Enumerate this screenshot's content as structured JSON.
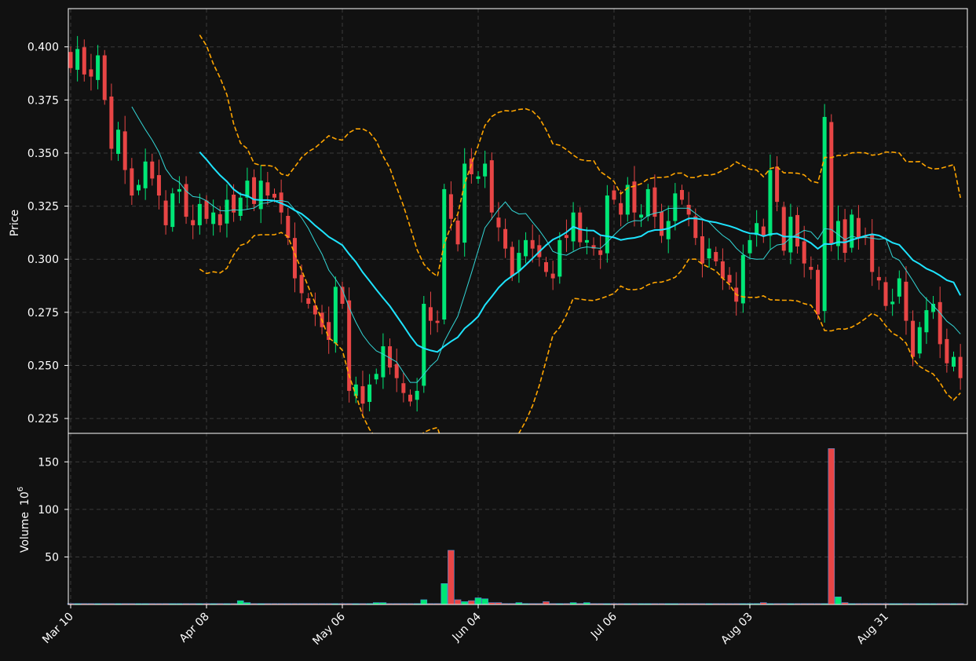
{
  "chart_data": {
    "type": "candlestick",
    "ylabel": "Price",
    "volume_label": "Volume",
    "volume_unit": "10",
    "volume_exp": "6",
    "ylim": [
      0.218,
      0.418
    ],
    "volume_ylim": [
      0,
      180
    ],
    "price_ticks": [
      "0.225",
      "0.250",
      "0.275",
      "0.300",
      "0.325",
      "0.350",
      "0.375",
      "0.400"
    ],
    "volume_ticks": [
      "50",
      "100",
      "150"
    ],
    "x_ticks": [
      {
        "label": "Mar 10",
        "index": 0
      },
      {
        "label": "Apr 08",
        "index": 20
      },
      {
        "label": "May 06",
        "index": 40
      },
      {
        "label": "Jun 04",
        "index": 60
      },
      {
        "label": "Jul 06",
        "index": 80
      },
      {
        "label": "Aug 03",
        "index": 100
      },
      {
        "label": "Aug 31",
        "index": 120
      }
    ],
    "grid": true,
    "colors": {
      "background": "#111111",
      "up": "#00e676",
      "down": "#e84545",
      "ma_short": "#33d6d6",
      "ma_long": "#1ee4ff",
      "bands": "#ffa500",
      "grid": "#3a3a3a",
      "text": "#ffffff",
      "volume_edge": "#4a90d9"
    },
    "close": [
      0.39,
      0.399,
      0.387,
      0.386,
      0.396,
      0.375,
      0.352,
      0.361,
      0.342,
      0.33,
      0.335,
      0.346,
      0.338,
      0.33,
      0.316,
      0.331,
      0.333,
      0.32,
      0.316,
      0.326,
      0.319,
      0.322,
      0.316,
      0.328,
      0.322,
      0.329,
      0.337,
      0.326,
      0.337,
      0.33,
      0.329,
      0.322,
      0.31,
      0.291,
      0.284,
      0.279,
      0.274,
      0.268,
      0.262,
      0.287,
      0.279,
      0.238,
      0.241,
      0.232,
      0.241,
      0.246,
      0.259,
      0.249,
      0.244,
      0.237,
      0.233,
      0.238,
      0.279,
      0.271,
      0.27,
      0.333,
      0.319,
      0.307,
      0.345,
      0.34,
      0.339,
      0.345,
      0.322,
      0.315,
      0.305,
      0.292,
      0.303,
      0.309,
      0.305,
      0.301,
      0.294,
      0.291,
      0.309,
      0.31,
      0.322,
      0.308,
      0.309,
      0.305,
      0.302,
      0.33,
      0.328,
      0.321,
      0.335,
      0.322,
      0.321,
      0.333,
      0.32,
      0.311,
      0.318,
      0.331,
      0.328,
      0.321,
      0.31,
      0.298,
      0.305,
      0.299,
      0.291,
      0.289,
      0.28,
      0.302,
      0.309,
      0.317,
      0.311,
      0.342,
      0.327,
      0.304,
      0.32,
      0.306,
      0.298,
      0.295,
      0.274,
      0.367,
      0.307,
      0.318,
      0.303,
      0.321,
      0.31,
      0.31,
      0.294,
      0.29,
      0.278,
      0.28,
      0.291,
      0.271,
      0.254,
      0.268,
      0.276,
      0.279,
      0.26,
      0.251,
      0.254,
      0.244
    ],
    "volume_millions": [
      1,
      1,
      1,
      1,
      1,
      1,
      1,
      1,
      1,
      1,
      1,
      1,
      1,
      1,
      1,
      1,
      1,
      1,
      1,
      1,
      1,
      1,
      1,
      1,
      1,
      4,
      2,
      1,
      1,
      1,
      1,
      1,
      1,
      1,
      1,
      1,
      1,
      1,
      1,
      1,
      1,
      1,
      1,
      1,
      1,
      2,
      2,
      1,
      1,
      1,
      1,
      1,
      5,
      1,
      1,
      22,
      57,
      5,
      3,
      4,
      7,
      6,
      2,
      2,
      1,
      1,
      2,
      1,
      1,
      1,
      3,
      1,
      1,
      1,
      2,
      1,
      2,
      1,
      1,
      1,
      1,
      1,
      1,
      1,
      1,
      1,
      1,
      1,
      1,
      1,
      1,
      1,
      1,
      1,
      1,
      1,
      1,
      1,
      1,
      1,
      1,
      1,
      2,
      1,
      1,
      1,
      1,
      1,
      1,
      1,
      1,
      1,
      164,
      8,
      2,
      1,
      1,
      1,
      1,
      1,
      1,
      1,
      1,
      1,
      1,
      1,
      1,
      1,
      1,
      1,
      1,
      1,
      2
    ]
  }
}
